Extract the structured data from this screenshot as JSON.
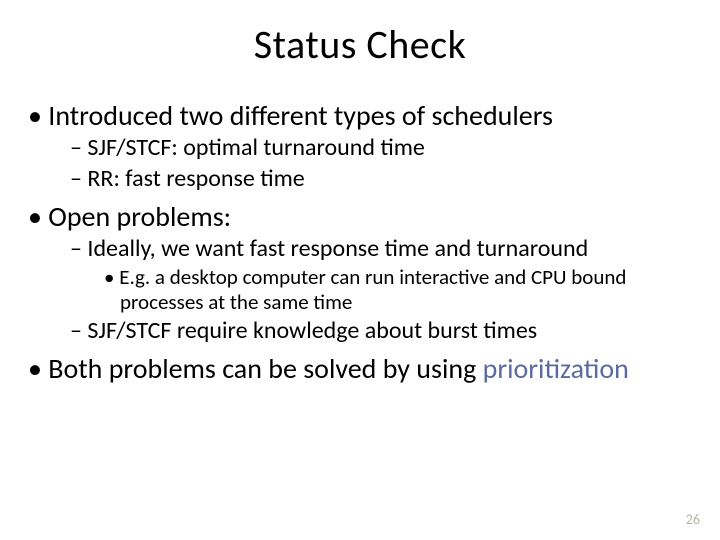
{
  "title": "Status Check",
  "bullets": {
    "b1": "Introduced two different types of schedulers",
    "b1a": "SJF/STCF: optimal turnaround time",
    "b1b": "RR: fast response time",
    "b2": "Open problems:",
    "b2a": "Ideally, we want fast response time and turnaround",
    "b2a1": "E.g. a desktop computer can run interactive and CPU bound processes at the same time",
    "b2b": "SJF/STCF require knowledge about burst times",
    "b3_pre": "Both problems can be solved by using ",
    "b3_accent": "prioritization"
  },
  "page_number": "26"
}
